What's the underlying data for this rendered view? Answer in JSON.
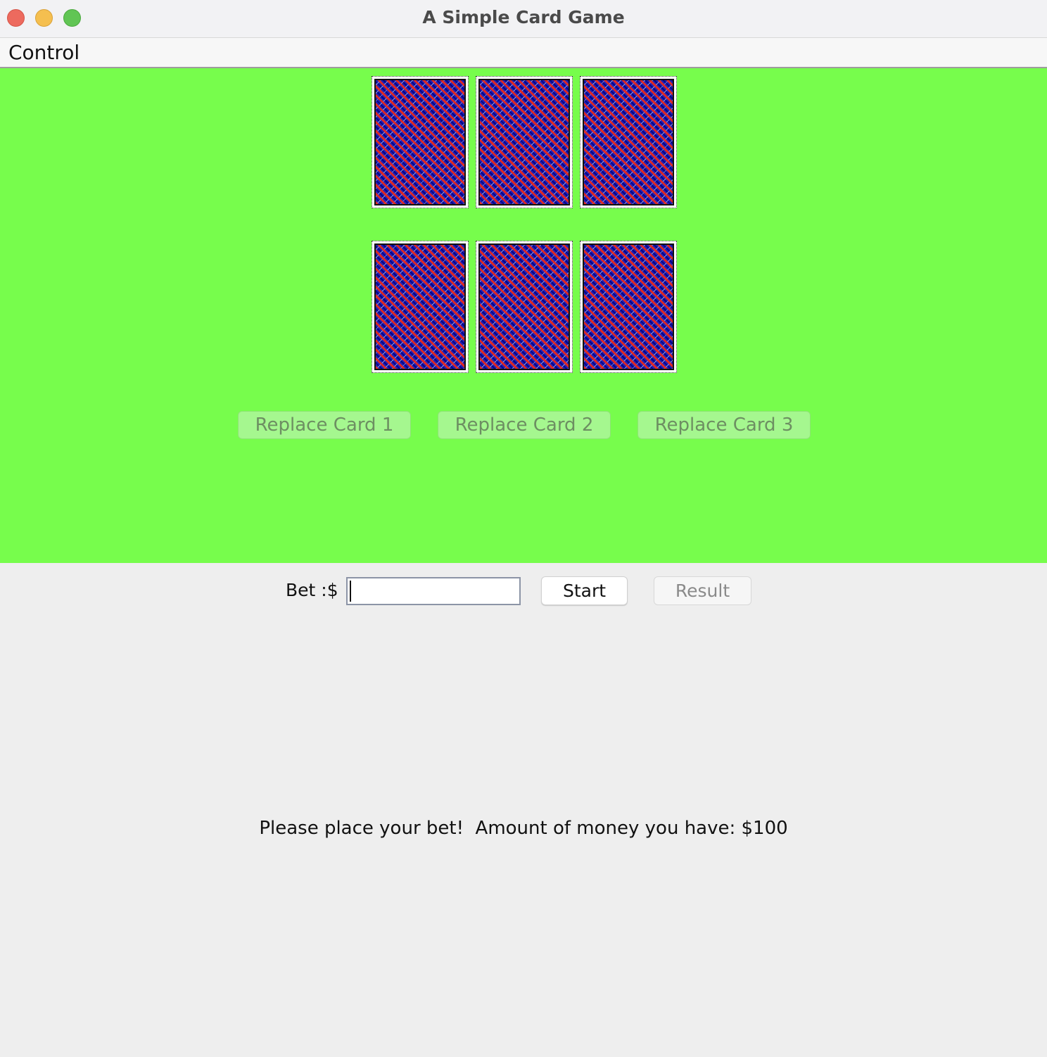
{
  "window": {
    "title": "A Simple Card Game"
  },
  "menubar": {
    "items": [
      {
        "label": "Control"
      }
    ]
  },
  "table": {
    "background_color": "#77fd4c",
    "dealer_cards": [
      {
        "face": "back"
      },
      {
        "face": "back"
      },
      {
        "face": "back"
      }
    ],
    "player_cards": [
      {
        "face": "back"
      },
      {
        "face": "back"
      },
      {
        "face": "back"
      }
    ],
    "replace_buttons": [
      {
        "label": "Replace Card 1",
        "enabled": false
      },
      {
        "label": "Replace Card 2",
        "enabled": false
      },
      {
        "label": "Replace Card 3",
        "enabled": false
      }
    ]
  },
  "controls": {
    "bet_label": "Bet :$",
    "bet_input_value": "",
    "start_label": "Start",
    "result_label": "Result",
    "result_enabled": false
  },
  "status": {
    "message": "Please place your bet!  Amount of money you have: $100"
  }
}
